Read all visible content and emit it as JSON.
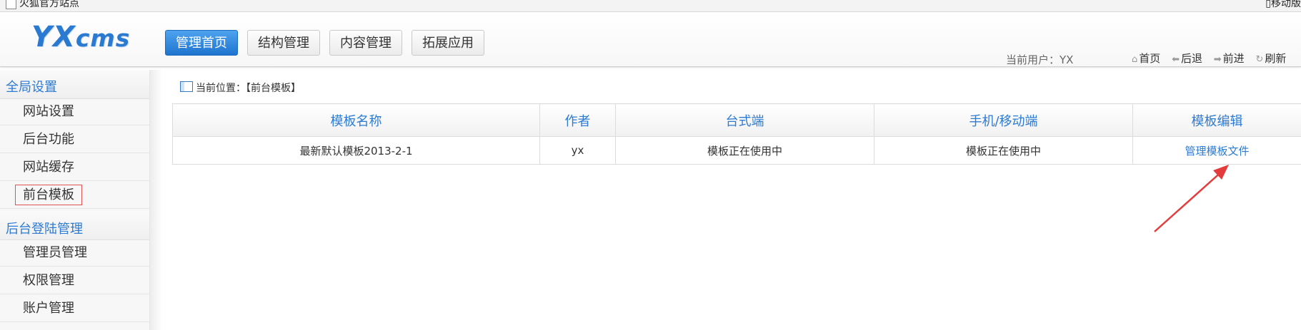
{
  "bookmarks": {
    "left_label": "火狐官方站点",
    "right_label": "移动版"
  },
  "header": {
    "logo": {
      "main": "YX",
      "small": "cms"
    },
    "nav": [
      {
        "label": "管理首页",
        "active": true
      },
      {
        "label": "结构管理",
        "active": false
      },
      {
        "label": "内容管理",
        "active": false
      },
      {
        "label": "拓展应用",
        "active": false
      }
    ],
    "current_user": "当前用户：YX",
    "tools": [
      {
        "icon": "home-icon",
        "label": "首页"
      },
      {
        "icon": "back-arrow-icon",
        "label": "后退"
      },
      {
        "icon": "forward-arrow-icon",
        "label": "前进"
      },
      {
        "icon": "refresh-icon",
        "label": "刷新"
      }
    ]
  },
  "sidebar": {
    "groups": [
      {
        "title": "全局设置",
        "items": [
          {
            "label": "网站设置"
          },
          {
            "label": "后台功能"
          },
          {
            "label": "网站缓存"
          },
          {
            "label": "前台模板",
            "active": true
          }
        ]
      },
      {
        "title": "后台登陆管理",
        "items": [
          {
            "label": "管理员管理"
          },
          {
            "label": "权限管理"
          },
          {
            "label": "账户管理"
          }
        ]
      }
    ]
  },
  "main": {
    "breadcrumb": "当前位置：【前台模板】",
    "table": {
      "headers": [
        "模板名称",
        "作者",
        "台式端",
        "手机/移动端",
        "模板编辑"
      ],
      "rows": [
        {
          "name": "最新默认模板2013-2-1",
          "author": "yx",
          "desktop": "模板正在使用中",
          "mobile": "模板正在使用中",
          "edit": "管理模板文件"
        }
      ]
    }
  },
  "colors": {
    "accent": "#2d7bd3",
    "in_use": "#e31b1b",
    "annotation": "#e23c3c"
  }
}
